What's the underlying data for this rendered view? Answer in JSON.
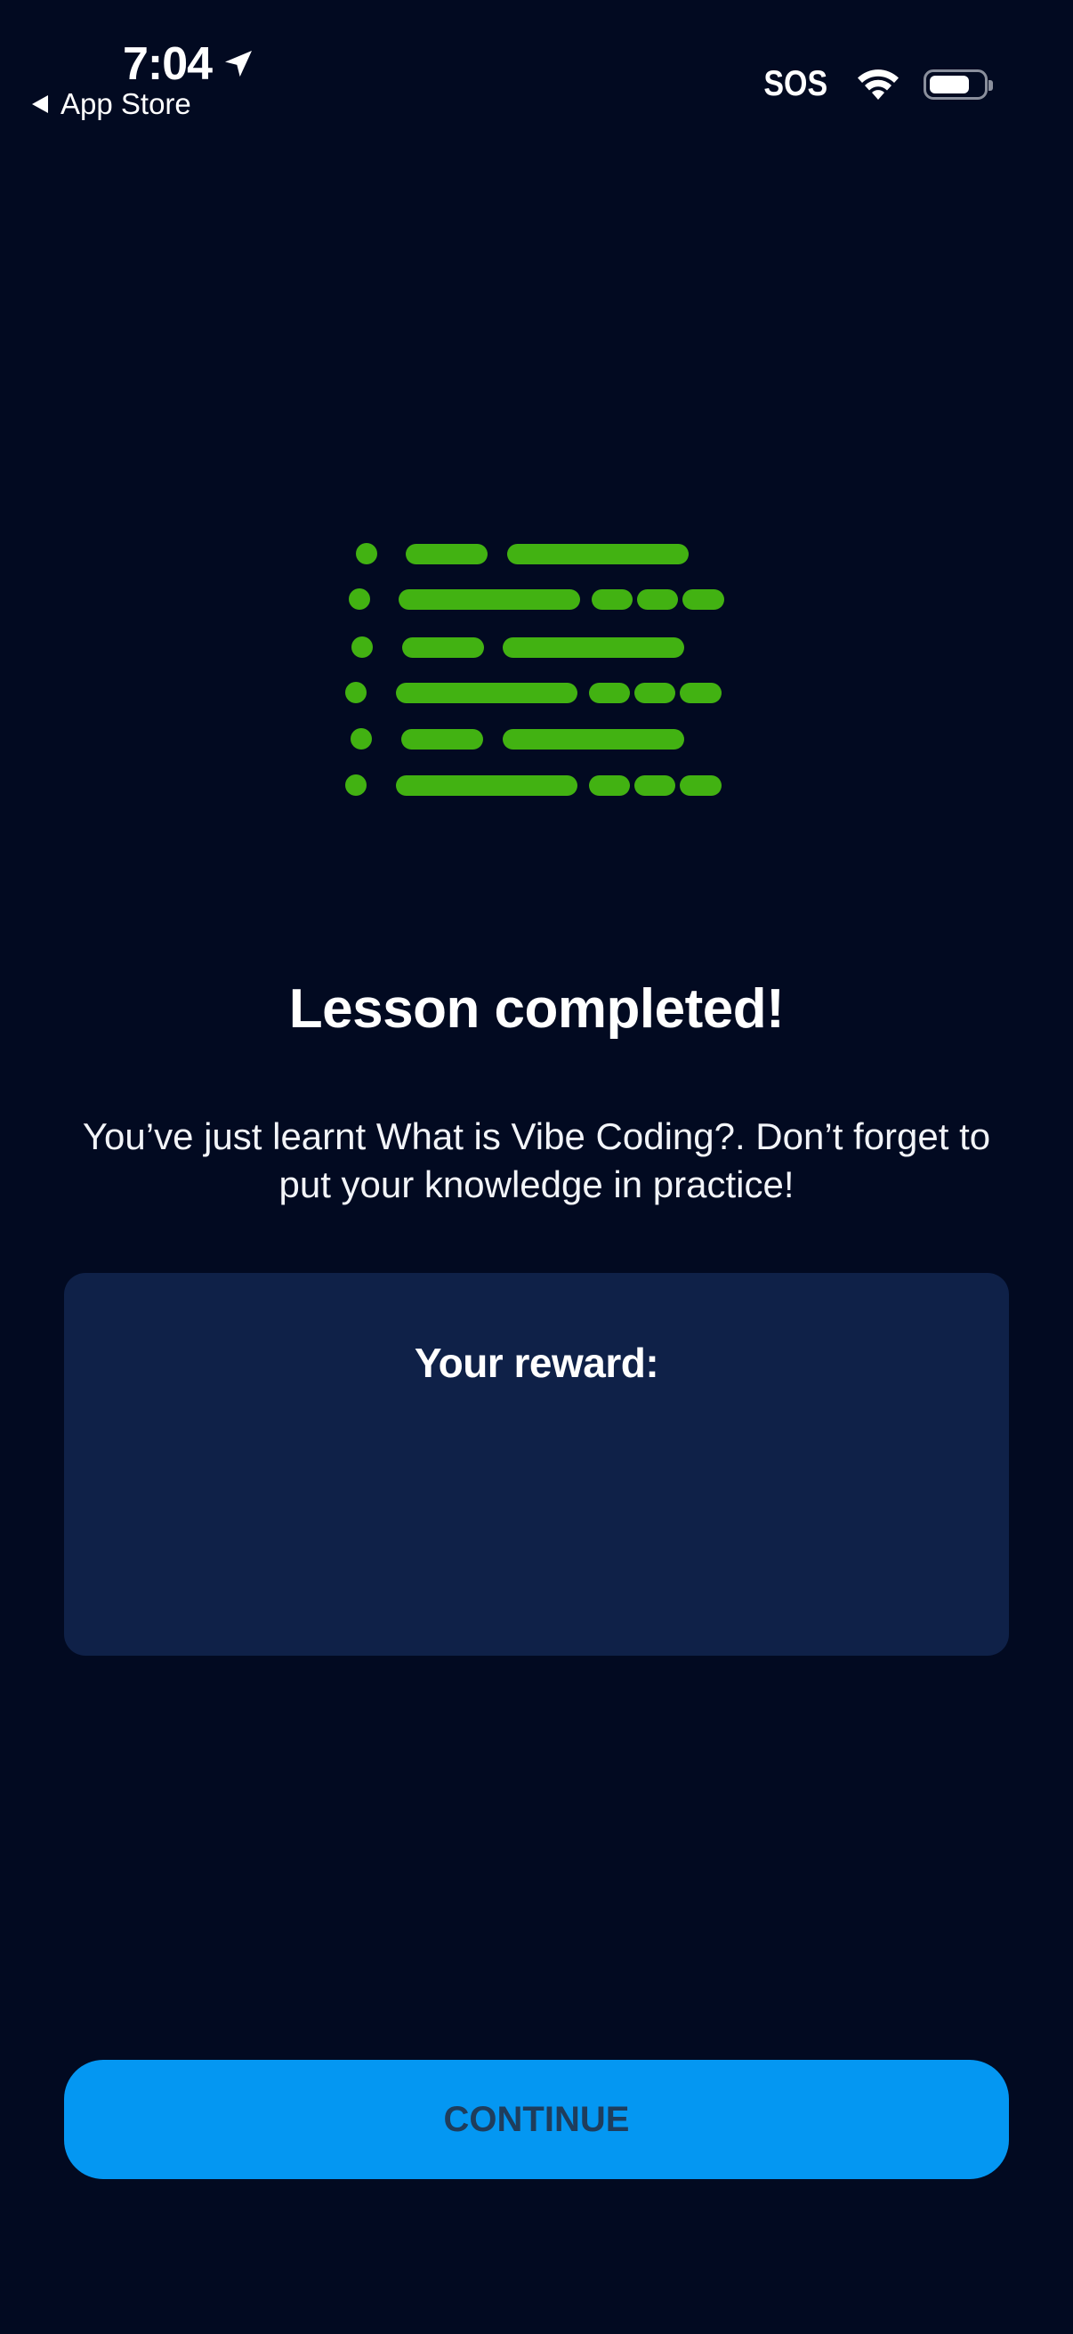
{
  "status_bar": {
    "time": "7:04",
    "back_label": "App Store",
    "carrier": "SOS",
    "location_icon": "location-arrow-icon",
    "wifi_icon": "wifi-icon",
    "battery_icon": "battery-icon"
  },
  "illustration": {
    "icon": "code-lines-icon",
    "color": "#42b212"
  },
  "lesson": {
    "title": "Lesson completed!",
    "message": "You’ve just learnt What is Vibe Coding?. Don’t forget to put your knowledge in practice!"
  },
  "reward": {
    "label": "Your reward:"
  },
  "actions": {
    "continue_label": "CONTINUE"
  },
  "colors": {
    "background": "#020a21",
    "card": "#0f2148",
    "button": "#0497f2",
    "button_text": "#1f3d5c",
    "accent_green": "#42b212"
  }
}
